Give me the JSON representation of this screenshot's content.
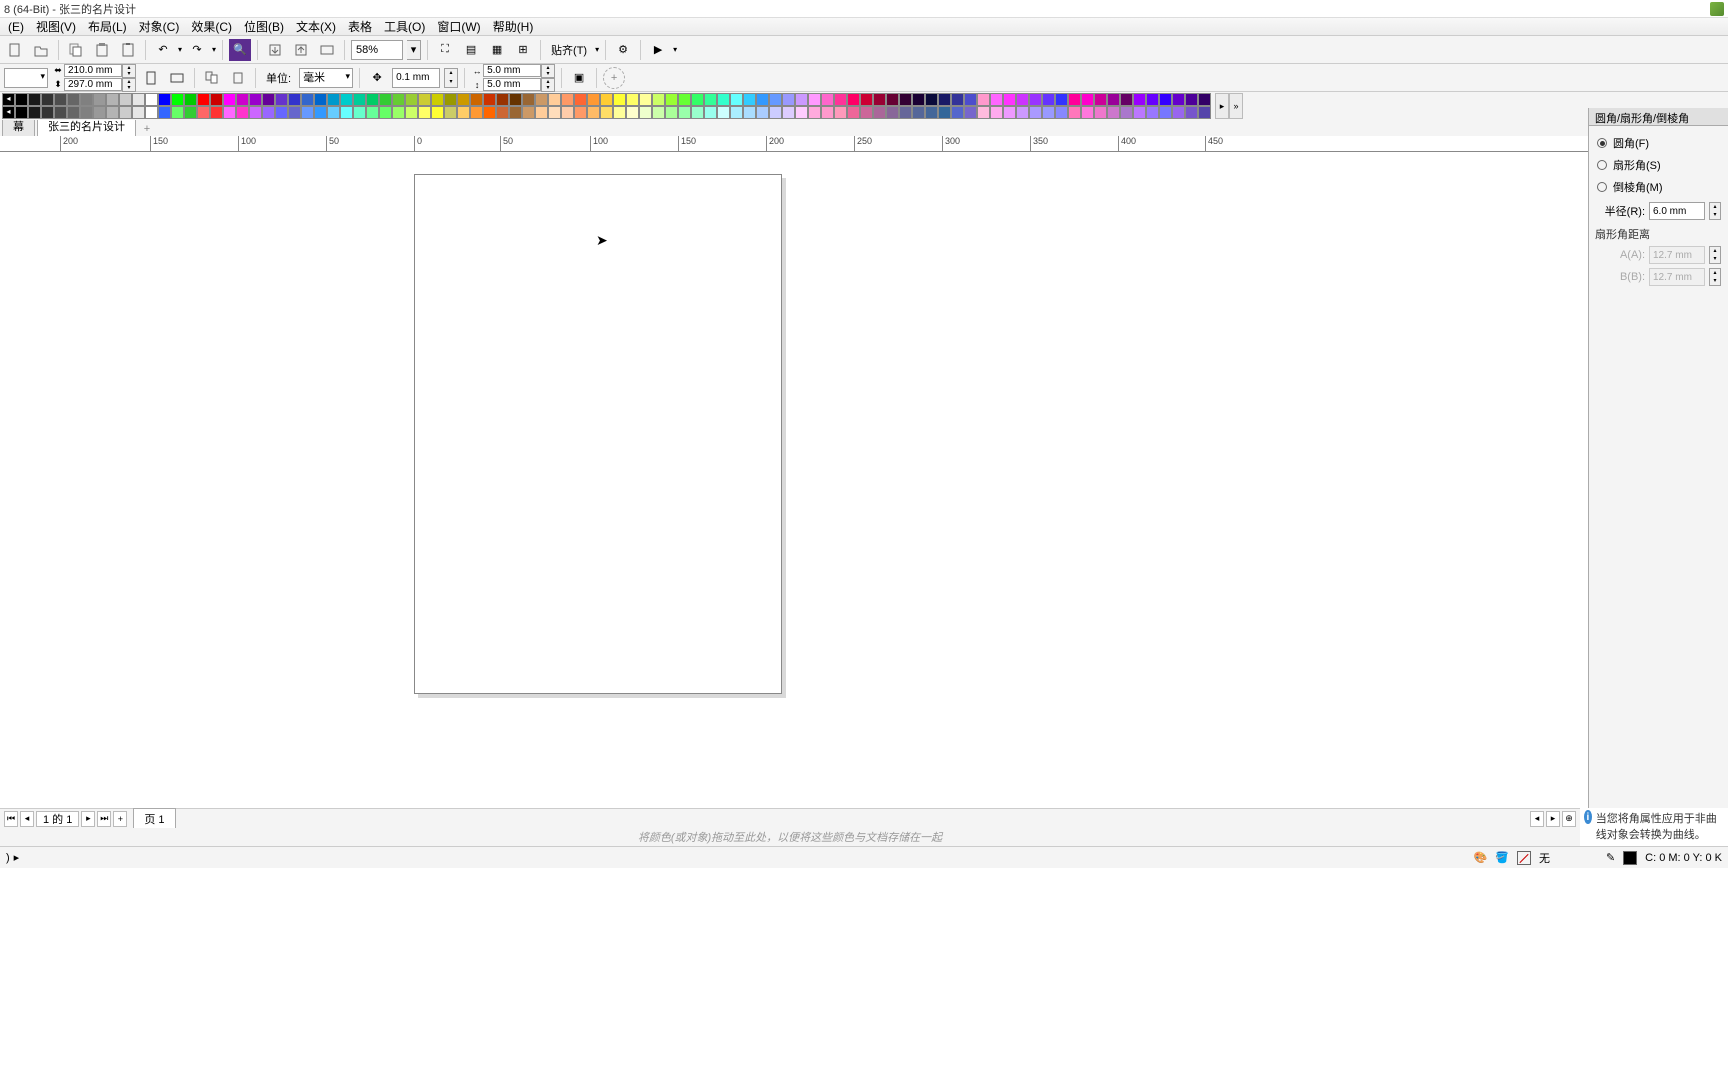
{
  "title": "8 (64-Bit) - 张三的名片设计",
  "menu": [
    "(E)",
    "视图(V)",
    "布局(L)",
    "对象(C)",
    "效果(C)",
    "位图(B)",
    "文本(X)",
    "表格",
    "工具(O)",
    "窗口(W)",
    "帮助(H)"
  ],
  "toolbar1": {
    "zoom": "58%",
    "snap_label": "贴齐(T)"
  },
  "toolbar2": {
    "pageW": "210.0 mm",
    "pageH": "297.0 mm",
    "unit_label": "单位:",
    "unit_value": "毫米",
    "nudge": "0.1 mm",
    "dupX": "5.0 mm",
    "dupY": "5.0 mm"
  },
  "doc_tabs": {
    "t1": "幕",
    "t2": "张三的名片设计"
  },
  "ruler_marks": [
    "200",
    "150",
    "100",
    "50",
    "0",
    "50",
    "100",
    "150",
    "200",
    "250",
    "300",
    "350",
    "400",
    "450"
  ],
  "ruler_unit": "毫米",
  "docker": {
    "title": "圆角/扇形角/倒棱角",
    "r1": "圆角(F)",
    "r2": "扇形角(S)",
    "r3": "倒棱角(M)",
    "radius_label": "半径(R):",
    "radius_value": "6.0 mm",
    "sub": "扇形角距离",
    "alabel": "A(A):",
    "aval": "12.7 mm",
    "blabel": "B(B):",
    "bval": "12.7 mm"
  },
  "info_msg": "当您将角属性应用于非曲线对象会转换为曲线。",
  "pager": {
    "pos": "1 的 1",
    "tab": "页 1"
  },
  "hint": "将颜色(或对象)拖动至此处，以便将这些颜色与文档存储在一起",
  "status": {
    "none": "无",
    "cmyk": "C: 0 M: 0 Y: 0 K"
  },
  "palette_top": [
    "#000000",
    "#1a1a1a",
    "#333333",
    "#4d4d4d",
    "#666666",
    "#808080",
    "#999999",
    "#b3b3b3",
    "#cccccc",
    "#e6e6e6",
    "#ffffff",
    "#0000ff",
    "#00ff00",
    "#00cc00",
    "#ff0000",
    "#cc0000",
    "#ff00ff",
    "#cc00cc",
    "#9900cc",
    "#660099",
    "#6633cc",
    "#3333cc",
    "#3366cc",
    "#0066cc",
    "#0099cc",
    "#00cccc",
    "#00cc99",
    "#00cc66",
    "#33cc33",
    "#66cc33",
    "#99cc33",
    "#cccc33",
    "#cccc00",
    "#999900",
    "#cc9900",
    "#cc6600",
    "#cc3300",
    "#993300",
    "#663300",
    "#996633",
    "#cc9966",
    "#ffcc99",
    "#ff9966",
    "#ff6633",
    "#ff9933",
    "#ffcc33",
    "#ffff33",
    "#ffff66",
    "#ffff99",
    "#ccff66",
    "#99ff33",
    "#66ff33",
    "#33ff66",
    "#33ff99",
    "#33ffcc",
    "#66ffff",
    "#33ccff",
    "#3399ff",
    "#6699ff",
    "#9999ff",
    "#cc99ff",
    "#ff99ff",
    "#ff66cc",
    "#ff3399",
    "#ff0066",
    "#cc0033",
    "#990033",
    "#660033",
    "#330033",
    "#1a0033",
    "#0a0a3a",
    "#1a1a66",
    "#333399",
    "#4d4dcc",
    "#ff99cc",
    "#ff66ff",
    "#ff33ff",
    "#cc33ff",
    "#9933ff",
    "#6633ff",
    "#3333ff",
    "#ff0099",
    "#ff00cc",
    "#cc0099",
    "#990099",
    "#660066",
    "#9900ff",
    "#6600ff",
    "#3300ff",
    "#6600cc",
    "#4d0099",
    "#330066"
  ],
  "palette_bot": [
    "#000000",
    "#1a1a1a",
    "#333333",
    "#4d4d4d",
    "#666666",
    "#808080",
    "#999999",
    "#b3b3b3",
    "#cccccc",
    "#e6e6e6",
    "#ffffff",
    "#3366ff",
    "#66ff66",
    "#33cc33",
    "#ff6666",
    "#ff3333",
    "#ff66ff",
    "#ff33cc",
    "#cc66ff",
    "#9966ff",
    "#6666ff",
    "#6666cc",
    "#6699ff",
    "#3399ff",
    "#66ccff",
    "#66ffff",
    "#66ffcc",
    "#66ff99",
    "#66ff66",
    "#99ff66",
    "#ccff66",
    "#ffff66",
    "#ffff33",
    "#cccc66",
    "#ffcc66",
    "#ff9933",
    "#ff6600",
    "#cc6633",
    "#996633",
    "#cc9966",
    "#ffcc99",
    "#ffddbb",
    "#ffccaa",
    "#ff9966",
    "#ffbb66",
    "#ffdd66",
    "#ffff99",
    "#ffffcc",
    "#eeffcc",
    "#ccffaa",
    "#aaff99",
    "#99ffaa",
    "#99ffcc",
    "#99ffee",
    "#ccffff",
    "#aaeeff",
    "#aaddff",
    "#aaccff",
    "#ccccff",
    "#ddccff",
    "#ffccff",
    "#ffaadd",
    "#ff99cc",
    "#ff99bb",
    "#ee6699",
    "#cc6699",
    "#aa6699",
    "#886699",
    "#666699",
    "#556699",
    "#446699",
    "#336699",
    "#5566cc",
    "#7766cc",
    "#ffbbdd",
    "#ffaaee",
    "#ee99ff",
    "#cc99ff",
    "#aa99ff",
    "#9999ff",
    "#8888ff",
    "#ff77bb",
    "#ff77dd",
    "#ee77cc",
    "#cc77cc",
    "#aa77cc",
    "#bb77ff",
    "#9977ff",
    "#7777ff",
    "#9966ee",
    "#7755cc",
    "#5544aa"
  ]
}
